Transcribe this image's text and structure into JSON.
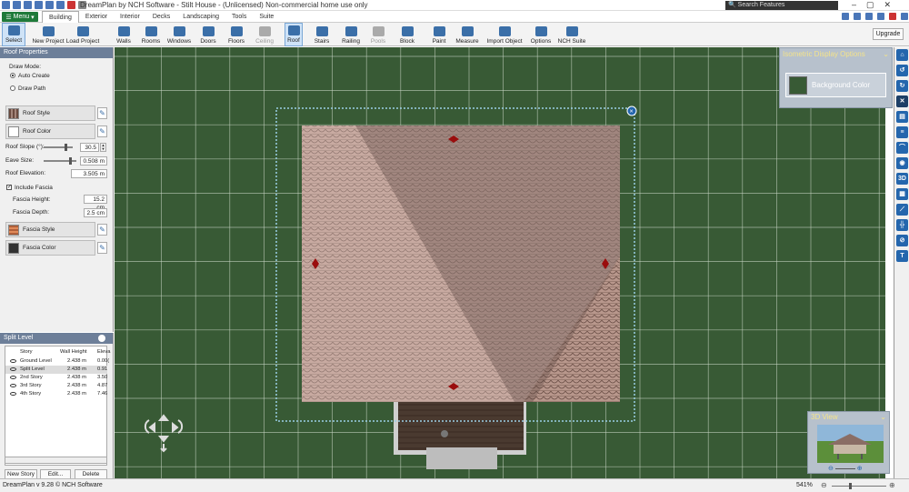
{
  "app": {
    "title": "DreamPlan by NCH Software - Stilt House - (Unlicensed) Non-commercial home use only",
    "search_placeholder": "Search Features",
    "menu_label": "Menu"
  },
  "tabs": [
    "Building",
    "Exterior",
    "Interior",
    "Decks",
    "Landscaping",
    "Tools",
    "Suite"
  ],
  "toolbar": {
    "tools": [
      "Select",
      "New Project",
      "Load Project",
      "Walls",
      "Rooms",
      "Windows",
      "Doors",
      "Floors",
      "Ceiling",
      "Roof",
      "Stairs",
      "Railing",
      "Pools",
      "Block",
      "Paint",
      "Measure",
      "Import Object",
      "Options",
      "NCH Suite"
    ],
    "upgrade": "Upgrade"
  },
  "roof_panel": {
    "title": "Roof Properties",
    "draw_mode_label": "Draw Mode:",
    "auto_create": "Auto Create",
    "draw_path": "Draw Path",
    "roof_style": "Roof Style",
    "roof_color": "Roof Color",
    "roof_slope_label": "Roof Slope (°):",
    "roof_slope_value": "30.5",
    "eave_size_label": "Eave Size:",
    "eave_size_value": "0.508 m",
    "roof_elevation_label": "Roof Elevation:",
    "roof_elevation_value": "3.505 m",
    "include_fascia": "Include Fascia",
    "fascia_height_label": "Fascia Height:",
    "fascia_height_value": "15.2 cm",
    "fascia_depth_label": "Fascia Depth:",
    "fascia_depth_value": "2.5 cm",
    "fascia_style": "Fascia Style",
    "fascia_color": "Fascia Color",
    "roof_slope_fraction": 0.75,
    "eave_size_fraction": 0.8
  },
  "split_panel": {
    "title": "Split Level",
    "headers": [
      "Story",
      "Wall Height",
      "Eleva"
    ],
    "rows": [
      [
        "Ground Level",
        "2.438 m",
        "0.00("
      ],
      [
        "Split Level",
        "2.438 m",
        "0.91"
      ],
      [
        "2nd Story",
        "2.438 m",
        "3.50"
      ],
      [
        "3rd Story",
        "2.438 m",
        "4.87"
      ],
      [
        "4th Story",
        "2.438 m",
        "7.46"
      ]
    ],
    "buttons": [
      "New Story",
      "Edit...",
      "Delete"
    ]
  },
  "iso_panel": {
    "title": "Isometric Display Options",
    "bg_color_label": "Background Color"
  },
  "right_toolbar": {
    "label_3d": "3D"
  },
  "view3d": {
    "title": "3D View"
  },
  "status": {
    "text": "DreamPlan v 9.28 © NCH Software",
    "zoom": "541%"
  },
  "colors": {
    "canvas_bg": "#385a35",
    "grid": "#c9d6c6",
    "roof_light": "#c8a9a0",
    "roof_dark": "#7d6862",
    "accent": "#2466ad",
    "marker": "#9a0d0d"
  }
}
